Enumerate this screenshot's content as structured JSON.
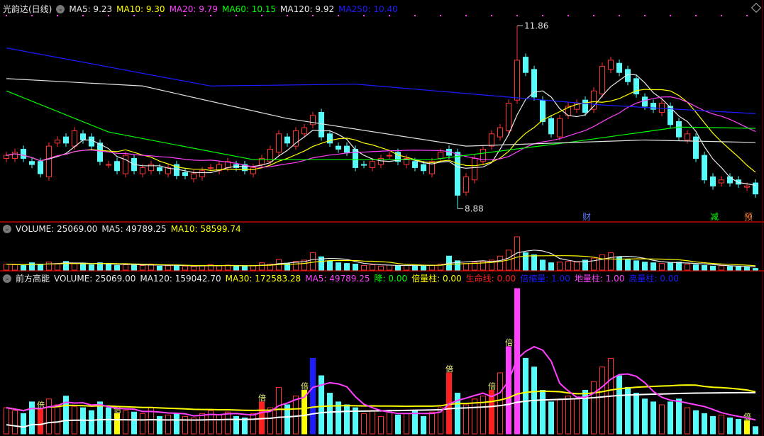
{
  "main_header": {
    "title": "光韵达(日线)",
    "ma5": "MA5: 9.23",
    "ma10": "MA10: 9.30",
    "ma20": "MA20: 9.79",
    "ma60": "MA60: 10.15",
    "ma120": "MA120: 9.92",
    "ma250": "MA250: 10.40"
  },
  "vol_header": {
    "volume": "VOLUME: 25069.00",
    "ma5": "MA5: 49789.25",
    "ma10": "MA10: 58599.74"
  },
  "ind_header": {
    "title": "前方高能",
    "volume": "VOLUME: 25069.00",
    "ma120": "MA120: 159042.70",
    "ma30": "MA30: 172583.28",
    "ma5": "MA5: 49789.25",
    "jiang": "降: 0.00",
    "beiliang": "倍量柱: 0.00",
    "shengming": "生命线: 0.00",
    "beisuo": "倍缩量: 1.00",
    "diliang": "地量柱: 1.00",
    "gaoliang": "高量柱: 0.00"
  },
  "colors": {
    "up": "#ff3232",
    "down": "#54fcfc",
    "ma5": "#e8e8e8",
    "ma10": "#ffff00",
    "ma20": "#ff40ff",
    "ma60": "#00ff00",
    "ma120": "#e0e0e0",
    "ma250": "#1c1cff"
  },
  "chart_data": {
    "type": "candlestick",
    "price_range": [
      8.7,
      12.05
    ],
    "high_label": "11.86",
    "low_label": "8.88",
    "high_index": 60,
    "low_index": 53,
    "closes": [
      9.75,
      9.8,
      9.7,
      9.6,
      9.45,
      9.9,
      10.0,
      9.95,
      10.15,
      10.0,
      9.9,
      9.65,
      9.6,
      9.5,
      9.75,
      9.5,
      9.55,
      9.6,
      9.5,
      9.55,
      9.42,
      9.42,
      9.45,
      9.5,
      9.55,
      9.6,
      9.65,
      9.55,
      9.5,
      9.55,
      9.7,
      9.85,
      10.1,
      9.95,
      10.15,
      10.2,
      10.4,
      10.05,
      9.95,
      9.85,
      9.8,
      9.55,
      9.6,
      9.65,
      9.7,
      9.75,
      9.65,
      9.7,
      9.55,
      9.5,
      9.65,
      9.8,
      9.75,
      9.1,
      9.4,
      9.7,
      9.85,
      10.1,
      10.2,
      10.6,
      11.3,
      11.1,
      10.7,
      10.3,
      10.1,
      10.35,
      10.55,
      10.6,
      10.45,
      10.8,
      11.2,
      11.3,
      11.1,
      10.95,
      10.75,
      10.55,
      10.5,
      10.6,
      10.25,
      10.05,
      10.1,
      9.7,
      9.35,
      9.25,
      9.35,
      9.3,
      9.28,
      9.25,
      9.12
    ],
    "volumes": [
      90,
      80,
      70,
      110,
      85,
      120,
      100,
      130,
      95,
      90,
      80,
      110,
      90,
      70,
      80,
      75,
      70,
      90,
      60,
      65,
      70,
      60,
      55,
      70,
      80,
      65,
      75,
      60,
      55,
      70,
      110,
      90,
      160,
      100,
      130,
      150,
      260,
      200,
      140,
      110,
      100,
      90,
      70,
      80,
      60,
      75,
      65,
      70,
      80,
      60,
      75,
      90,
      210,
      140,
      100,
      120,
      130,
      150,
      210,
      300,
      500,
      260,
      230,
      150,
      110,
      120,
      130,
      120,
      150,
      180,
      230,
      260,
      200,
      160,
      140,
      120,
      110,
      100,
      110,
      120,
      90,
      80,
      70,
      60,
      65,
      55,
      50,
      45,
      25
    ],
    "volume_unit": "thousand",
    "ma60": [
      [
        0,
        10.8
      ],
      [
        12,
        10.13
      ],
      [
        29,
        9.68
      ],
      [
        50,
        9.68
      ],
      [
        66,
        9.96
      ],
      [
        79,
        10.21
      ],
      [
        88,
        10.19
      ]
    ],
    "ma120": [
      [
        0,
        11.0
      ],
      [
        16,
        10.88
      ],
      [
        33,
        10.35
      ],
      [
        54,
        9.9
      ],
      [
        75,
        10.0
      ],
      [
        88,
        9.96
      ]
    ],
    "ma250": [
      [
        0,
        11.5
      ],
      [
        24,
        10.88
      ],
      [
        41,
        10.91
      ],
      [
        70,
        10.57
      ],
      [
        88,
        10.43
      ]
    ],
    "event_markers": [
      {
        "index": 68,
        "label": "财",
        "color": "#5a78ff"
      },
      {
        "index": 83,
        "label": "减",
        "color": "#00ff00"
      },
      {
        "index": 87,
        "label": "预",
        "color": "#ff8030"
      }
    ],
    "special_bars": [
      {
        "index": 4,
        "color": "#ff2020",
        "label": "倍"
      },
      {
        "index": 13,
        "color": "#ffff00",
        "label": "倍"
      },
      {
        "index": 30,
        "color": "#ff2020",
        "label": "倍"
      },
      {
        "index": 35,
        "color": "#ffff00",
        "label": "倍"
      },
      {
        "index": 36,
        "color": "#1c1cff",
        "label": ""
      },
      {
        "index": 52,
        "color": "#ff2020",
        "label": "倍"
      },
      {
        "index": 57,
        "color": "#ff2020",
        "label": "倍"
      },
      {
        "index": 59,
        "color": "#ff40ff",
        "label": "倍"
      },
      {
        "index": 60,
        "color": "#ff40ff",
        "label": ""
      },
      {
        "index": 87,
        "color": "#ffff00",
        "label": "倍"
      }
    ]
  }
}
